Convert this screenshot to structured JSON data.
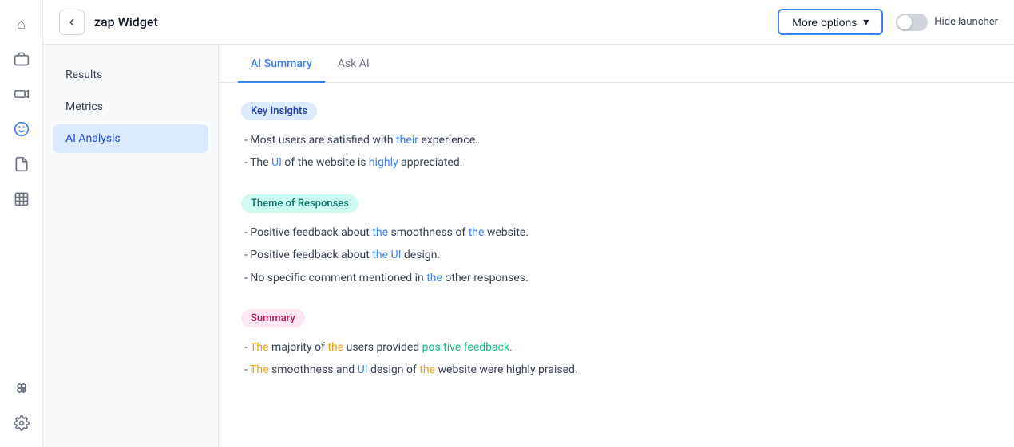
{
  "sidebar": {
    "icons": [
      {
        "name": "home-icon",
        "glyph": "⌂",
        "active": false
      },
      {
        "name": "box-icon",
        "glyph": "▣",
        "active": false
      },
      {
        "name": "video-icon",
        "glyph": "▶",
        "active": false
      },
      {
        "name": "smiley-icon",
        "glyph": "☺",
        "active": true
      },
      {
        "name": "document-icon",
        "glyph": "📄",
        "active": false
      },
      {
        "name": "chart-icon",
        "glyph": "▦",
        "active": false
      },
      {
        "name": "apps-icon",
        "glyph": "⊞",
        "active": false
      },
      {
        "name": "settings-icon",
        "glyph": "⚙",
        "active": false
      }
    ]
  },
  "header": {
    "title": "zap Widget",
    "back_label": "←",
    "more_options_label": "More options",
    "more_options_arrow": "▾",
    "hide_launcher_label": "Hide launcher"
  },
  "left_nav": {
    "items": [
      {
        "label": "Results",
        "active": false
      },
      {
        "label": "Metrics",
        "active": false
      },
      {
        "label": "AI Analysis",
        "active": true
      }
    ]
  },
  "tabs": [
    {
      "label": "AI Summary",
      "active": true
    },
    {
      "label": "Ask AI",
      "active": false
    }
  ],
  "ai_summary": {
    "key_insights": {
      "badge": "Key Insights",
      "bullets": [
        "- Most users are satisfied with their experience.",
        "- The UI of the website is highly appreciated."
      ]
    },
    "theme_of_responses": {
      "badge": "Theme of Responses",
      "bullets": [
        "- Positive feedback about the smoothness of the website.",
        "- Positive feedback about the UI design.",
        "- No specific comment mentioned in the other responses."
      ]
    },
    "summary": {
      "badge": "Summary",
      "bullets": [
        "- The majority of the users provided positive feedback.",
        "- The smoothness and UI design of the website were highly praised."
      ]
    }
  }
}
